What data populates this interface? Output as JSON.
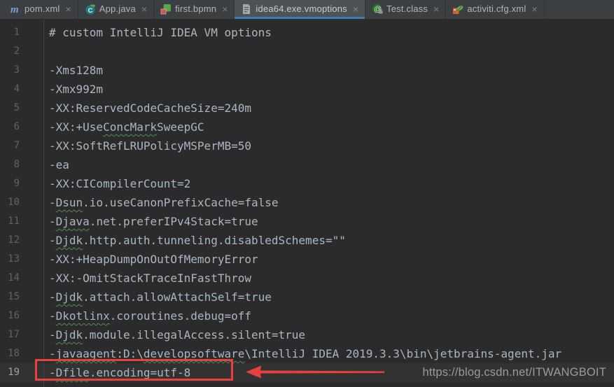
{
  "window_title": "idea64.exe.vmoptions",
  "tabbar": {
    "close_glyph": "×",
    "tabs": [
      {
        "label": "pom.xml",
        "icon": "maven-icon",
        "active": false
      },
      {
        "label": "App.java",
        "icon": "java-class-icon",
        "active": false
      },
      {
        "label": "first.bpmn",
        "icon": "bpmn-icon",
        "active": false
      },
      {
        "label": "idea64.exe.vmoptions",
        "icon": "file-icon",
        "active": true
      },
      {
        "label": "Test.class",
        "icon": "class-icon",
        "active": false
      },
      {
        "label": "activiti.cfg.xml",
        "icon": "spring-config-icon",
        "active": false
      }
    ]
  },
  "editor": {
    "current_line": 19,
    "lines": [
      {
        "num": 1,
        "segments": [
          {
            "text": "# custom IntelliJ IDEA VM options",
            "squiggle": false
          }
        ]
      },
      {
        "num": 2,
        "segments": []
      },
      {
        "num": 3,
        "segments": [
          {
            "text": "-Xms128m",
            "squiggle": false
          }
        ]
      },
      {
        "num": 4,
        "segments": [
          {
            "text": "-Xmx992m",
            "squiggle": false
          }
        ]
      },
      {
        "num": 5,
        "segments": [
          {
            "text": "-XX:ReservedCodeCacheSize=240m",
            "squiggle": false
          }
        ]
      },
      {
        "num": 6,
        "segments": [
          {
            "text": "-XX:+Use",
            "squiggle": false
          },
          {
            "text": "ConcMark",
            "squiggle": true
          },
          {
            "text": "SweepGC",
            "squiggle": false
          }
        ]
      },
      {
        "num": 7,
        "segments": [
          {
            "text": "-XX:SoftRefLRUPolicyMSPerMB=50",
            "squiggle": false
          }
        ]
      },
      {
        "num": 8,
        "segments": [
          {
            "text": "-ea",
            "squiggle": false
          }
        ]
      },
      {
        "num": 9,
        "segments": [
          {
            "text": "-XX:CICompilerCount=2",
            "squiggle": false
          }
        ]
      },
      {
        "num": 10,
        "segments": [
          {
            "text": "-",
            "squiggle": false
          },
          {
            "text": "Dsun",
            "squiggle": true
          },
          {
            "text": ".io.useCanonPrefixCache=false",
            "squiggle": false
          }
        ]
      },
      {
        "num": 11,
        "segments": [
          {
            "text": "-",
            "squiggle": false
          },
          {
            "text": "Djava",
            "squiggle": true
          },
          {
            "text": ".net.preferIPv4Stack=true",
            "squiggle": false
          }
        ]
      },
      {
        "num": 12,
        "segments": [
          {
            "text": "-",
            "squiggle": false
          },
          {
            "text": "Djdk",
            "squiggle": true
          },
          {
            "text": ".http.auth.tunneling.disabledSchemes=\"\"",
            "squiggle": false
          }
        ]
      },
      {
        "num": 13,
        "segments": [
          {
            "text": "-XX:+HeapDumpOnOutOfMemoryError",
            "squiggle": false
          }
        ]
      },
      {
        "num": 14,
        "segments": [
          {
            "text": "-XX:-OmitStackTraceInFastThrow",
            "squiggle": false
          }
        ]
      },
      {
        "num": 15,
        "segments": [
          {
            "text": "-",
            "squiggle": false
          },
          {
            "text": "Djdk",
            "squiggle": true
          },
          {
            "text": ".attach.allowAttachSelf=true",
            "squiggle": false
          }
        ]
      },
      {
        "num": 16,
        "segments": [
          {
            "text": "-",
            "squiggle": false
          },
          {
            "text": "Dkotlinx",
            "squiggle": true
          },
          {
            "text": ".coroutines.debug=off",
            "squiggle": false
          }
        ]
      },
      {
        "num": 17,
        "segments": [
          {
            "text": "-",
            "squiggle": false
          },
          {
            "text": "Djdk",
            "squiggle": true
          },
          {
            "text": ".module.illegalAccess.silent=true",
            "squiggle": false
          }
        ]
      },
      {
        "num": 18,
        "segments": [
          {
            "text": "-",
            "squiggle": false
          },
          {
            "text": "javaagent",
            "squiggle": true
          },
          {
            "text": ":D:\\",
            "squiggle": false
          },
          {
            "text": "developsoftware",
            "squiggle": true
          },
          {
            "text": "\\IntelliJ IDEA 2019.3.3\\bin\\jetbrains-agent.jar",
            "squiggle": false
          }
        ]
      },
      {
        "num": 19,
        "segments": [
          {
            "text": "-",
            "squiggle": false
          },
          {
            "text": "Dfile",
            "squiggle": true
          },
          {
            "text": ".encoding=utf-8",
            "squiggle": false
          }
        ]
      }
    ]
  },
  "overlay": {
    "watermark": "https://blog.csdn.net/ITWANGBOIT",
    "highlighted_line_text": "-Dfile.encoding=utf-8",
    "highlighted_line_number": 19
  },
  "colors": {
    "editor_bg": "#2b2b2b",
    "tabbar_bg": "#3c3f41",
    "active_tab_bg": "#4d5254",
    "tab_underline": "#3e7db8",
    "text": "#a9b7c6",
    "line_number": "#606366",
    "current_line_number": "#a4a3a3",
    "current_line_bg": "#323232",
    "annotation_red": "#e8413c",
    "watermark": "#9b9b9b",
    "squiggle": "#4e8f52"
  }
}
